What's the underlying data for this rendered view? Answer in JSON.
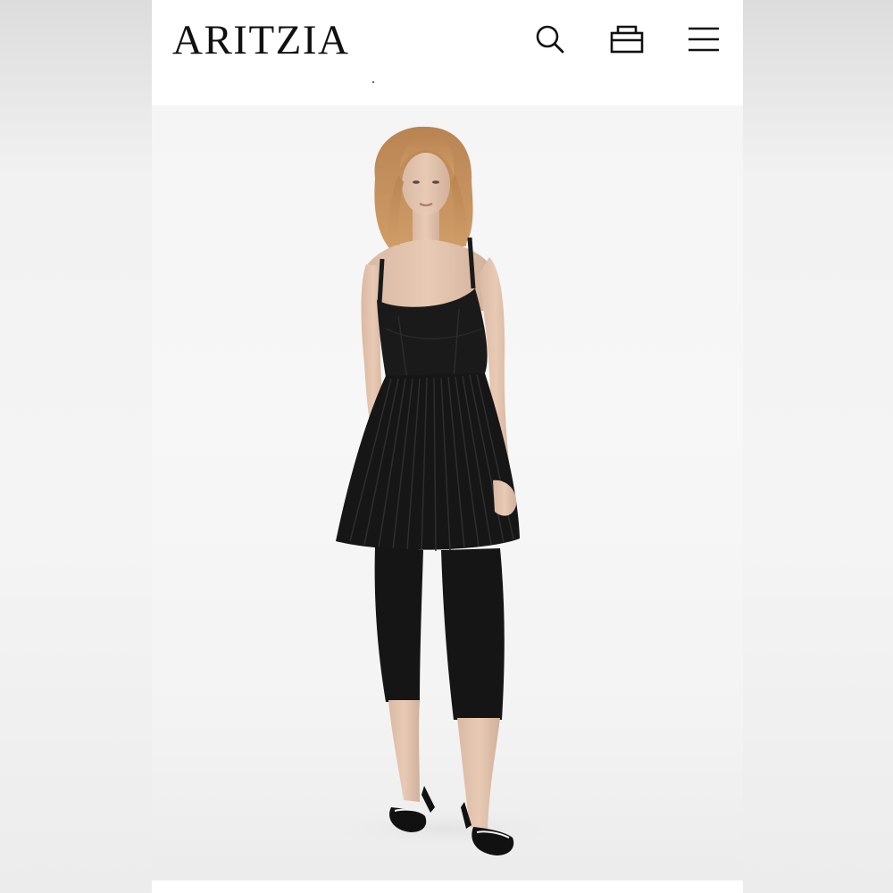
{
  "header": {
    "brand": "ARITZIA",
    "icons": [
      "search-icon",
      "shopping-bag-icon",
      "hamburger-menu-icon"
    ]
  },
  "hero": {
    "image": "model-in-black-pleated-dress-icon"
  },
  "colors": {
    "background": "#f3f3f3",
    "header": "#ffffff",
    "text": "#111111",
    "garment": "#1a1a1a"
  }
}
